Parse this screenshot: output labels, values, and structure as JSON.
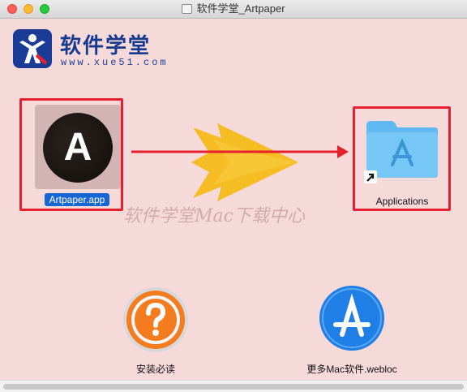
{
  "window": {
    "title": "软件学堂_Artpaper",
    "title_icon": "disk-image-icon"
  },
  "logo": {
    "name": "软件学堂",
    "url": "www.xue51.com"
  },
  "items": {
    "app": {
      "label": "Artpaper.app",
      "icon_letter": "A"
    },
    "applications": {
      "label": "Applications"
    },
    "help": {
      "label": "安装必读"
    },
    "more": {
      "label": "更多Mac软件.webloc"
    }
  },
  "watermark": "软件学堂Mac下载中心",
  "colors": {
    "background": "#f6d9d9",
    "highlight": "#e5202e",
    "selection": "#1666d6",
    "folder": "#5fb8f2",
    "arrow": "#f5b80f"
  }
}
